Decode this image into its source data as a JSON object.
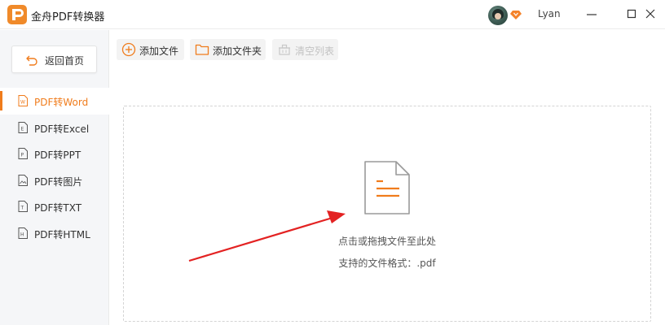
{
  "app": {
    "title": "金舟PDF转换器",
    "brand_color": "#f08a2a",
    "accent_color": "#f07c1c"
  },
  "user": {
    "name": "Lyan",
    "badge_icon": "vip-diamond-icon"
  },
  "window_controls": {
    "minimize": "window-minimize-icon",
    "maximize": "window-maximize-icon",
    "close": "window-close-icon"
  },
  "sidebar": {
    "back_label": "返回首页",
    "items": [
      {
        "label": "PDF转Word",
        "icon": "word-file-icon",
        "active": true
      },
      {
        "label": "PDF转Excel",
        "icon": "excel-file-icon",
        "active": false
      },
      {
        "label": "PDF转PPT",
        "icon": "ppt-file-icon",
        "active": false
      },
      {
        "label": "PDF转图片",
        "icon": "image-file-icon",
        "active": false
      },
      {
        "label": "PDF转TXT",
        "icon": "txt-file-icon",
        "active": false
      },
      {
        "label": "PDF转HTML",
        "icon": "html-file-icon",
        "active": false
      }
    ]
  },
  "toolbar": {
    "add_file": "添加文件",
    "add_folder": "添加文件夹",
    "clear_list": "清空列表"
  },
  "dropzone": {
    "hint": "点击或拖拽文件至此处",
    "formats": "支持的文件格式：.pdf"
  }
}
